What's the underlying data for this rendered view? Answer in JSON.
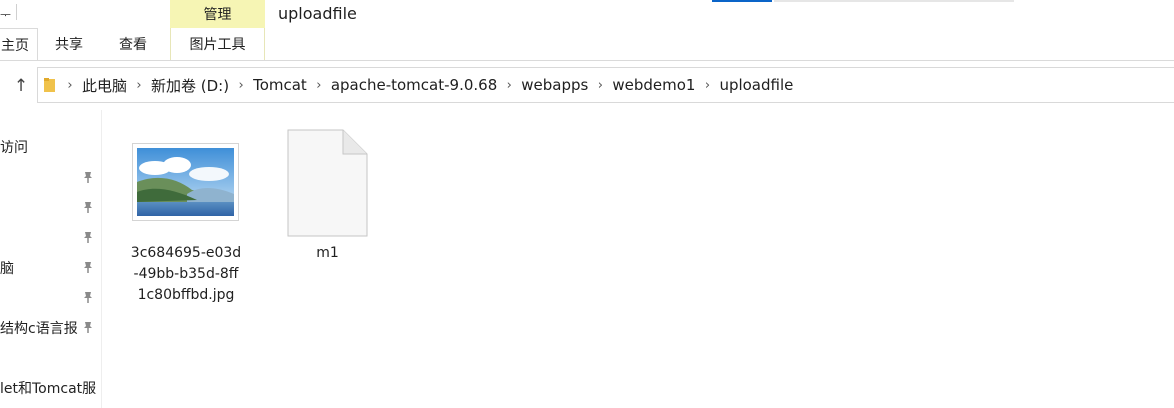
{
  "window": {
    "title": "uploadfile",
    "quick_access_fragment": "ᅮ",
    "contextual_tab": "管理"
  },
  "ribbon": {
    "tabs": [
      "主页",
      "共享",
      "查看",
      "图片工具"
    ]
  },
  "address_bar": {
    "breadcrumbs": [
      "此电脑",
      "新加卷 (D:)",
      "Tomcat",
      "apache-tomcat-9.0.68",
      "webapps",
      "webdemo1",
      "uploadfile"
    ]
  },
  "nav_pane": {
    "items": [
      {
        "label": "访问",
        "pinned": false
      },
      {
        "label": "",
        "pinned": true
      },
      {
        "label": "",
        "pinned": true
      },
      {
        "label": "",
        "pinned": true
      },
      {
        "label": "脑",
        "pinned": true
      },
      {
        "label": "",
        "pinned": true
      },
      {
        "label": "结构c语言报",
        "pinned": true
      },
      {
        "label": "let和Tomcat服",
        "pinned": false
      }
    ]
  },
  "files": [
    {
      "name": "3c684695-e03d-49bb-b35d-8ff1c80bffbd.jpg",
      "name_lines": [
        "3c684695-e03d",
        "-49bb-b35d-8ff",
        "1c80bffbd.jpg"
      ],
      "kind": "image"
    },
    {
      "name": "m1",
      "name_lines": [
        "m1"
      ],
      "kind": "file"
    }
  ],
  "icons": [
    "up-arrow-icon",
    "folder-icon",
    "chevron-right-icon",
    "pin-icon",
    "image-file-icon",
    "blank-file-icon"
  ],
  "colors": {
    "contextual_tab": "#f6f5b4",
    "accent": "#0a64c8",
    "border": "#d9d9d9"
  }
}
